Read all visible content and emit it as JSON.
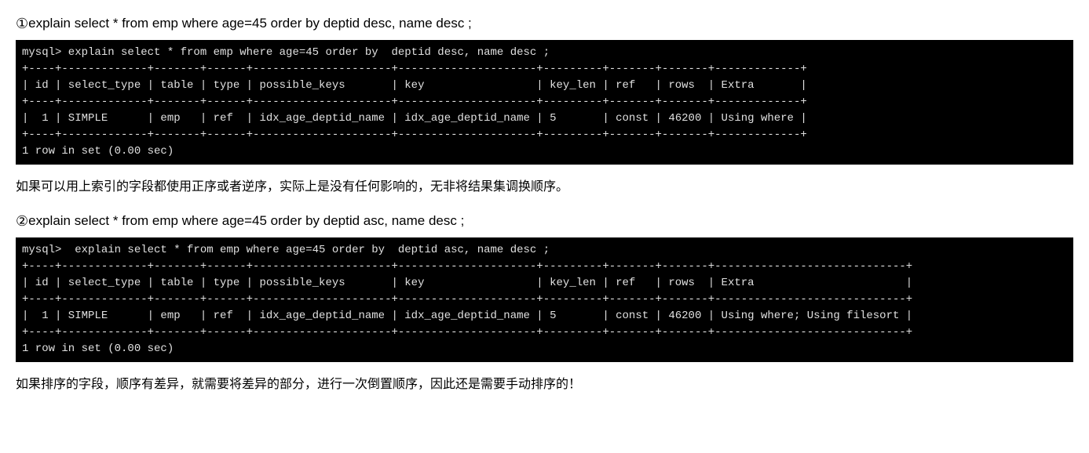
{
  "section1": {
    "marker": "①",
    "query_text": "explain select * from emp where age=45 order by   deptid desc, name desc ;",
    "terminal": {
      "prompt_line": "mysql> explain select * from emp where age=45 order by  deptid desc, name desc ;",
      "border_top": "+----+-------------+-------+------+---------------------+---------------------+---------+-------+-------+-------------+",
      "header_row": "| id | select_type | table | type | possible_keys       | key                 | key_len | ref   | rows  | Extra       |",
      "border_mid": "+----+-------------+-------+------+---------------------+---------------------+---------+-------+-------+-------------+",
      "data_row": "|  1 | SIMPLE      | emp   | ref  | idx_age_deptid_name | idx_age_deptid_name | 5       | const | 46200 | Using where |",
      "border_bot": "+----+-------------+-------+------+---------------------+---------------------+---------+-------+-------+-------------+",
      "footer": "1 row in set (0.00 sec)"
    },
    "explanation": "如果可以用上索引的字段都使用正序或者逆序，实际上是没有任何影响的，无非将结果集调换顺序。"
  },
  "section2": {
    "marker": "②",
    "query_text": "explain select * from emp where age=45 order by   deptid asc, name desc ;",
    "terminal": {
      "prompt_line": "mysql>  explain select * from emp where age=45 order by  deptid asc, name desc ;",
      "border_top": "+----+-------------+-------+------+---------------------+---------------------+---------+-------+-------+-----------------------------+",
      "header_row": "| id | select_type | table | type | possible_keys       | key                 | key_len | ref   | rows  | Extra                       |",
      "border_mid": "+----+-------------+-------+------+---------------------+---------------------+---------+-------+-------+-----------------------------+",
      "data_row": "|  1 | SIMPLE      | emp   | ref  | idx_age_deptid_name | idx_age_deptid_name | 5       | const | 46200 | Using where; Using filesort |",
      "border_bot": "+----+-------------+-------+------+---------------------+---------------------+---------+-------+-------+-----------------------------+",
      "footer": "1 row in set (0.00 sec)"
    },
    "explanation": "如果排序的字段，顺序有差异，就需要将差异的部分，进行一次倒置顺序，因此还是需要手动排序的！"
  }
}
